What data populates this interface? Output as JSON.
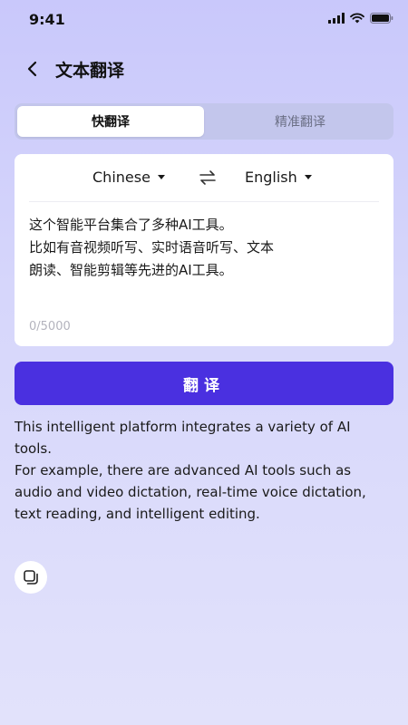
{
  "status_bar": {
    "time": "9:41",
    "icons": [
      "signal-icon",
      "wifi-icon",
      "battery-icon"
    ]
  },
  "header": {
    "back_icon": "chevron-left-icon",
    "title": "文本翻译"
  },
  "tabs": [
    {
      "label": "快翻译",
      "active": true
    },
    {
      "label": "精准翻译",
      "active": false
    }
  ],
  "translator": {
    "source_language": "Chinese",
    "target_language": "English",
    "swap_icon": "swap-arrows-icon",
    "source_text": "这个智能平台集合了多种AI工具。\n比如有音视频听写、实时语音听写、文本\n朗读、智能剪辑等先进的AI工具。",
    "char_count": "0/5000"
  },
  "translate_button": {
    "label": "翻译"
  },
  "result": {
    "text": "This intelligent platform integrates a variety of AI tools.\nFor example, there are advanced AI tools such as audio and video dictation, real-time voice dictation, text reading, and intelligent editing."
  },
  "copy_button": {
    "icon": "copy-icon"
  },
  "colors": {
    "accent": "#4a30e0",
    "tab_bg": "#c3c6ec",
    "muted_text": "#b3b3bd"
  }
}
